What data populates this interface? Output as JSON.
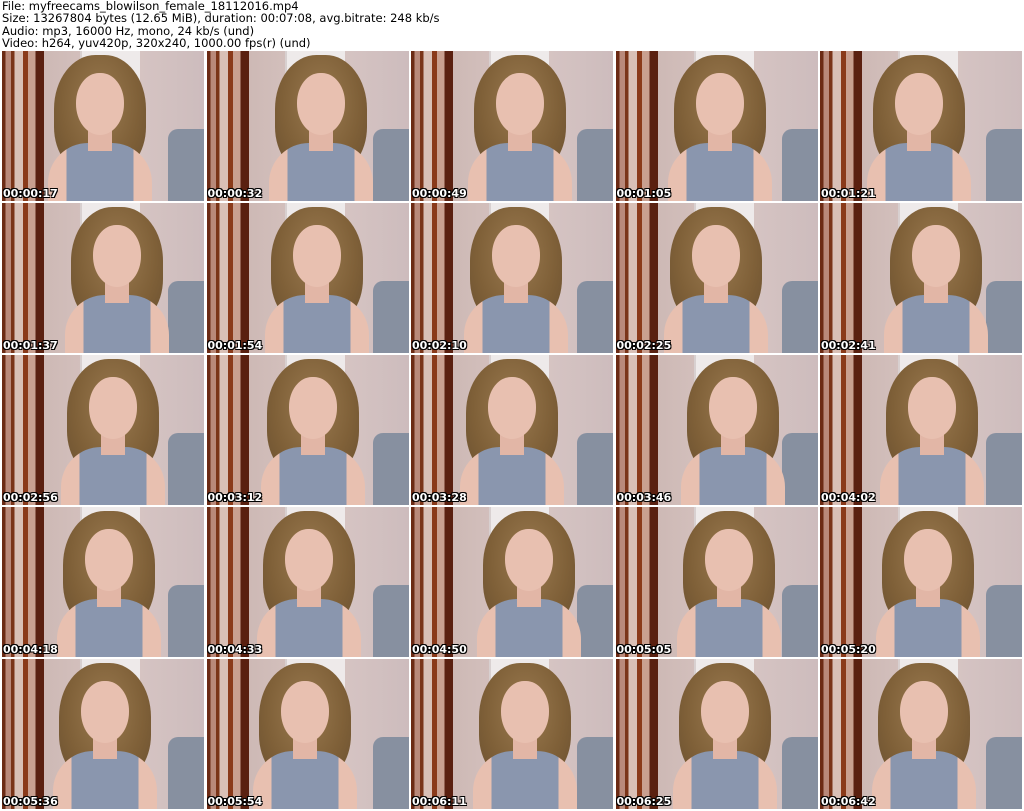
{
  "header": {
    "file": "File: myfreecams_blowilson_female_18112016.mp4",
    "size": "Size: 13267804 bytes (12.65 MiB), duration: 00:07:08, avg.bitrate: 248 kb/s",
    "audio": "Audio: mp3, 16000 Hz, mono, 24 kb/s (und)",
    "video": "Video: h264, yuv420p, 320x240, 1000.00 fps(r) (und)"
  },
  "timestamps": [
    "00:00:17",
    "00:00:32",
    "00:00:49",
    "00:01:05",
    "00:01:21",
    "00:01:37",
    "00:01:54",
    "00:02:10",
    "00:02:25",
    "00:02:41",
    "00:02:56",
    "00:03:12",
    "00:03:28",
    "00:03:46",
    "00:04:02",
    "00:04:18",
    "00:04:33",
    "00:04:50",
    "00:05:05",
    "00:05:20",
    "00:05:36",
    "00:05:54",
    "00:06:11",
    "00:06:25",
    "00:06:42"
  ]
}
